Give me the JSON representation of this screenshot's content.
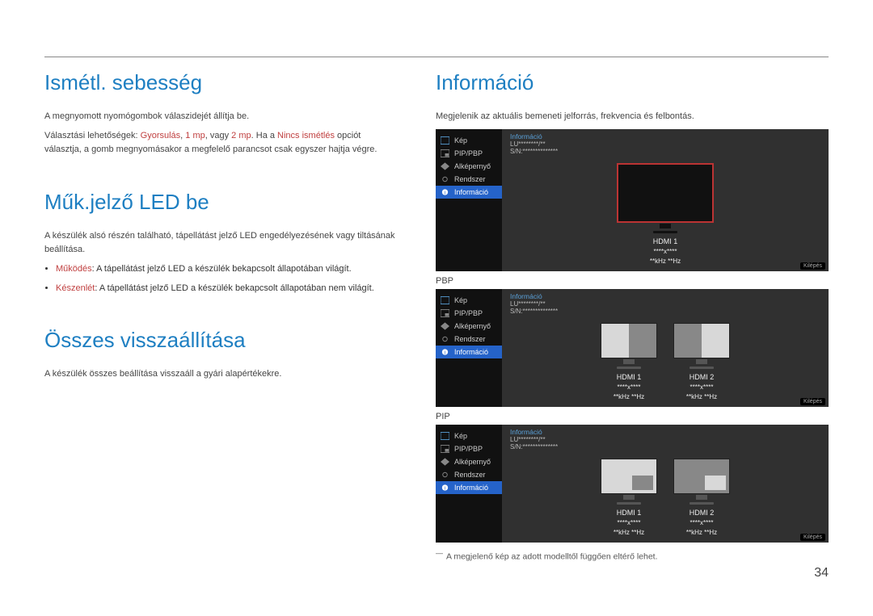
{
  "left": {
    "section1": {
      "title": "Ismétl. sebesség",
      "p1": "A megnyomott nyomógombok válaszidejét állítja be.",
      "p2a": "Választási lehetőségek: ",
      "p2b": "Gyorsulás",
      "p2c": ", ",
      "p2d": "1 mp",
      "p2e": ", vagy ",
      "p2f": "2 mp",
      "p2g": ". Ha a ",
      "p2h": "Nincs ismétlés",
      "p2i": " opciót választja, a gomb megnyomásakor a megfelelő parancsot csak egyszer hajtja végre."
    },
    "section2": {
      "title": "Műk.jelző LED be",
      "p1": "A készülék alsó részén található, tápellátást jelző LED engedélyezésének vagy tiltásának beállítása.",
      "b1_label": "Működés",
      "b1_text": ": A tápellátást jelző LED a készülék bekapcsolt állapotában világít.",
      "b2_label": "Készenlét",
      "b2_text": ": A tápellátást jelző LED a készülék bekapcsolt állapotában nem világít."
    },
    "section3": {
      "title": "Összes visszaállítása",
      "p1": "A készülék összes beállítása visszaáll a gyári alapértékekre."
    }
  },
  "right": {
    "title": "Információ",
    "p1": "Megjelenik az aktuális bemeneti jelforrás, frekvencia és felbontás.",
    "mode_pbp": "PBP",
    "mode_pip": "PIP",
    "footnote": "A megjelenő kép az adott modelltől függően eltérő lehet."
  },
  "osd": {
    "menu": {
      "kep": "Kép",
      "pip": "PIP/PBP",
      "alkepernyo": "Alképernyő",
      "rendszer": "Rendszer",
      "informacio": "Információ"
    },
    "info_header": {
      "title": "Információ",
      "model": "LU********/**",
      "sn": "S/N:**************"
    },
    "hdmi1": "HDMI 1",
    "hdmi2": "HDMI 2",
    "res": "****x****",
    "freq": "**kHz **Hz",
    "exit": "Kilépés"
  },
  "page_number": "34"
}
